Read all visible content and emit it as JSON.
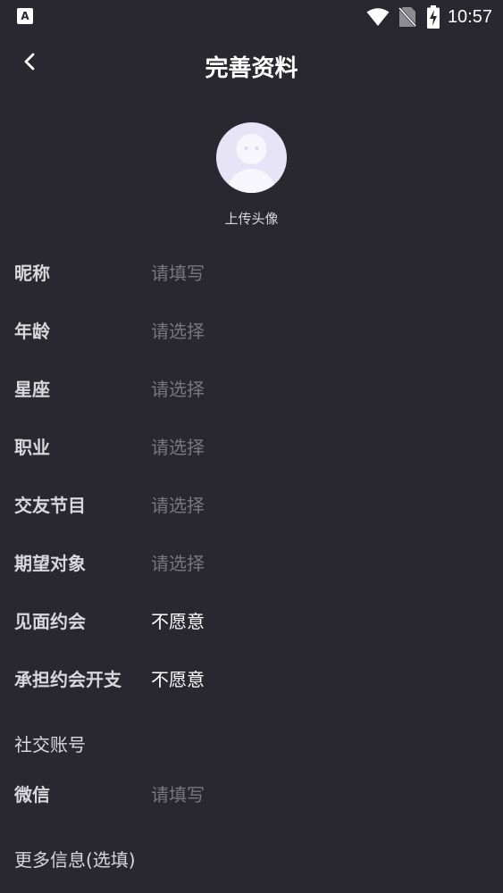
{
  "status_bar": {
    "app_icon_letter": "A",
    "time": "10:57"
  },
  "header": {
    "title": "完善资料"
  },
  "avatar": {
    "caption": "上传头像"
  },
  "form": {
    "rows": [
      {
        "label": "昵称",
        "value": "请填写"
      },
      {
        "label": "年龄",
        "value": "请选择"
      },
      {
        "label": "星座",
        "value": "请选择"
      },
      {
        "label": "职业",
        "value": "请选择"
      },
      {
        "label": "交友节目",
        "value": "请选择"
      },
      {
        "label": "期望对象",
        "value": "请选择"
      },
      {
        "label": "见面约会",
        "value": "不愿意"
      },
      {
        "label": "承担约会开支",
        "value": "不愿意"
      }
    ]
  },
  "social": {
    "section_title": "社交账号",
    "wechat_label": "微信",
    "wechat_value": "请填写"
  },
  "more_info": {
    "section_title": "更多信息(选填)"
  }
}
